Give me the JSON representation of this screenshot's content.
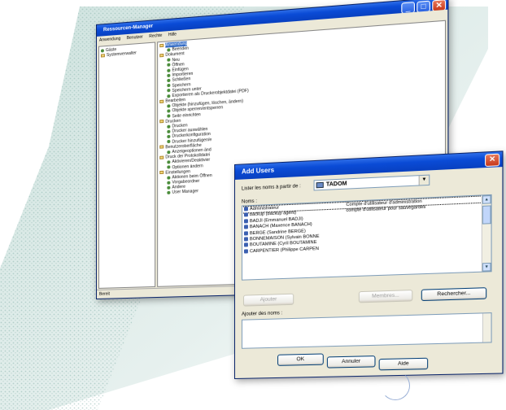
{
  "resource_manager": {
    "title": "Ressourcen-Manager",
    "menu": [
      "Anwendung",
      "Benutzer",
      "Rechte",
      "Hilfe"
    ],
    "left_tree": [
      "Gäste",
      "Systemverwalter"
    ],
    "right_tree": [
      {
        "label": "Anwendung",
        "kind": "box",
        "indent": 0,
        "selected": true
      },
      {
        "label": "Beenden",
        "kind": "dot",
        "indent": 1
      },
      {
        "label": "Dokument",
        "kind": "box",
        "indent": 0
      },
      {
        "label": "Neu",
        "kind": "dot",
        "indent": 1
      },
      {
        "label": "Öffnen",
        "kind": "dot",
        "indent": 1
      },
      {
        "label": "Einfügen",
        "kind": "dot",
        "indent": 1
      },
      {
        "label": "Importieren",
        "kind": "dot",
        "indent": 1
      },
      {
        "label": "Schließen",
        "kind": "dot",
        "indent": 1
      },
      {
        "label": "Speichern",
        "kind": "dot",
        "indent": 1
      },
      {
        "label": "Speichern unter",
        "kind": "dot",
        "indent": 1
      },
      {
        "label": "Exportieren als Druckerobjektdatei (PDF)",
        "kind": "dot",
        "indent": 1
      },
      {
        "label": "Bearbeiten",
        "kind": "box",
        "indent": 0
      },
      {
        "label": "Objekte (hinzufügen, löschen, ändern)",
        "kind": "dot",
        "indent": 1
      },
      {
        "label": "Objekte sperren/entsperren",
        "kind": "dot",
        "indent": 1
      },
      {
        "label": "Seite einrichten",
        "kind": "dot",
        "indent": 1
      },
      {
        "label": "Drucken",
        "kind": "box",
        "indent": 0
      },
      {
        "label": "Drucken",
        "kind": "dot",
        "indent": 1
      },
      {
        "label": "Drucker auswählen",
        "kind": "dot",
        "indent": 1
      },
      {
        "label": "Druckerkonfiguration",
        "kind": "dot",
        "indent": 1
      },
      {
        "label": "Drucker hinzufügen/e",
        "kind": "dot",
        "indent": 1
      },
      {
        "label": "Benutzeroberfläche",
        "kind": "box",
        "indent": 0
      },
      {
        "label": "Anzeigeoptionen änd",
        "kind": "dot",
        "indent": 1
      },
      {
        "label": "Druck der Protokolldatei",
        "kind": "box",
        "indent": 0
      },
      {
        "label": "Aktivieren/Deaktivier",
        "kind": "dot",
        "indent": 1
      },
      {
        "label": "Optionen ändern",
        "kind": "dot",
        "indent": 1
      },
      {
        "label": "Einstellungen",
        "kind": "box",
        "indent": 0
      },
      {
        "label": "Aktionen beim Öffnen",
        "kind": "dot",
        "indent": 1
      },
      {
        "label": "Vorgabeordner",
        "kind": "dot",
        "indent": 1
      },
      {
        "label": "Andere",
        "kind": "dot",
        "indent": 1
      },
      {
        "label": "User Manager",
        "kind": "dot",
        "indent": 1
      }
    ],
    "status": "Bereit",
    "colors": {
      "titlebar": "#0a4bd6",
      "close": "#c6381a"
    }
  },
  "add_users": {
    "title": "Add Users",
    "source_label": "Lister les noms à partir de :",
    "source_value": "TADOM",
    "names_label": "Noms :",
    "users": [
      {
        "name": "Administrateur",
        "desc": "Compte d'utilisateur d'administration",
        "selected": true
      },
      {
        "name": "backup (backup agent)",
        "desc": "compte d'utilisateur pour sauvegardes"
      },
      {
        "name": "BADJI (Emmanuel BADJI)",
        "desc": ""
      },
      {
        "name": "BANACH (Maxence BANACH)",
        "desc": ""
      },
      {
        "name": "BERGE (Sandrine BERGE)",
        "desc": ""
      },
      {
        "name": "BONNEMAISON (Sylvain BONNE",
        "desc": ""
      },
      {
        "name": "BOUTAMINE (Cyril BOUTAMINE",
        "desc": ""
      },
      {
        "name": "CARPENTIER (Philippe CARPEN",
        "desc": ""
      }
    ],
    "buttons": {
      "add": "Ajouter",
      "members": "Membres...",
      "search": "Rechercher...",
      "ok": "OK",
      "cancel": "Annuler",
      "help": "Aide"
    },
    "add_names_label": "Ajouter des noms :"
  }
}
